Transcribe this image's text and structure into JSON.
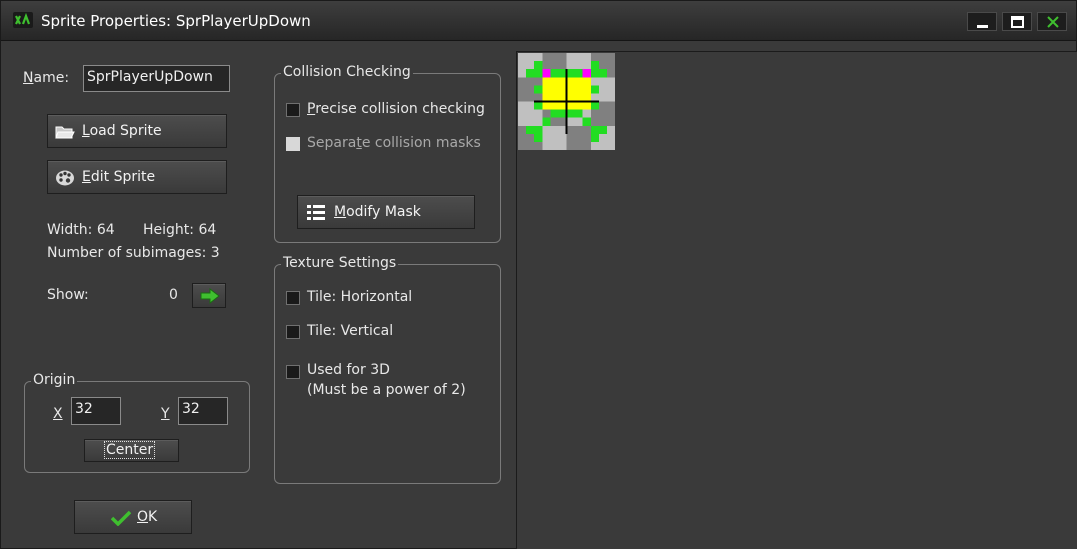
{
  "window": {
    "title": "Sprite Properties: SprPlayerUpDown",
    "controls": {
      "minimize": "minimize-icon",
      "maximize": "maximize-icon",
      "close": "close-icon"
    }
  },
  "name": {
    "label_prefix": "N",
    "label_rest": "ame:",
    "value": "SprPlayerUpDown"
  },
  "buttons": {
    "load_sprite": {
      "prefix": "L",
      "rest": "oad Sprite",
      "icon": "folder-icon"
    },
    "edit_sprite": {
      "prefix": "E",
      "rest": "dit Sprite",
      "icon": "palette-icon"
    },
    "modify_mask": {
      "prefix": "M",
      "rest": "odify Mask",
      "icon": "mask-list-icon"
    },
    "center": "Center",
    "ok": {
      "prefix": "O",
      "rest": "K",
      "icon": "checkmark-icon"
    }
  },
  "info": {
    "width": "Width: 64",
    "height": "Height: 64",
    "subimages": "Number of subimages: 3",
    "show_label": "Show:",
    "show_value": "0"
  },
  "origin": {
    "title": "Origin",
    "x_label": "X",
    "x_value": "32",
    "y_label": "Y",
    "y_value": "32"
  },
  "collision": {
    "title": "Collision Checking",
    "precise": {
      "prefix": "P",
      "rest": "recise collision checking",
      "checked": false
    },
    "separate": {
      "before": "Separa",
      "underlined": "t",
      "after": "e collision masks",
      "checked": false,
      "disabled": true
    }
  },
  "texture": {
    "title": "Texture Settings",
    "tile_h": {
      "label": "Tile: Horizontal",
      "checked": false
    },
    "tile_v": {
      "label": "Tile: Vertical",
      "checked": false
    },
    "used_3d": {
      "label": "Used for 3D",
      "note": "(Must be a power of 2)",
      "checked": false
    }
  },
  "colors": {
    "accent_green": "#3fbf2f",
    "sprite_green": "#22dd22",
    "sprite_yellow": "#ffff00",
    "sprite_magenta": "#ff00ff"
  }
}
